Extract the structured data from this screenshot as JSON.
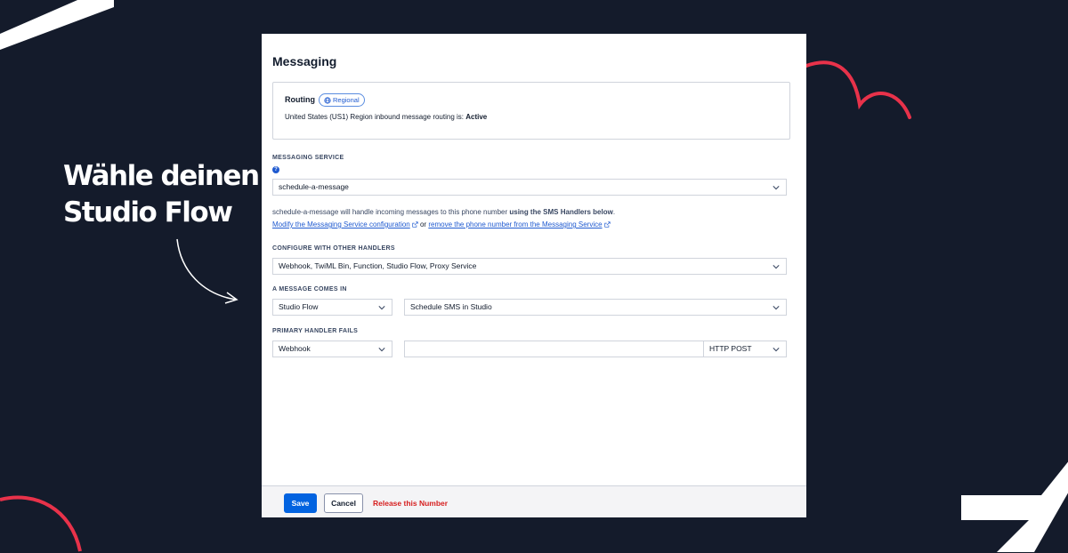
{
  "headline": {
    "line1": "Wähle deinen",
    "line2": "Studio Flow"
  },
  "panel": {
    "title": "Messaging",
    "routing": {
      "label": "Routing",
      "badge": "Regional",
      "text_prefix": "United States (US1) Region inbound message routing is: ",
      "status": "Active"
    },
    "messaging_service": {
      "label": "MESSAGING SERVICE",
      "value": "schedule-a-message",
      "note_prefix": "schedule-a-message will handle incoming messages to this phone number ",
      "note_bold": "using the SMS Handlers below",
      "note_suffix": ".",
      "modify_link": "Modify the Messaging Service configuration",
      "or_text": "or",
      "remove_link": "remove the phone number from the Messaging Service"
    },
    "configure": {
      "label": "CONFIGURE WITH OTHER HANDLERS",
      "value": "Webhook, TwiML Bin, Function, Studio Flow, Proxy Service"
    },
    "message_comes_in": {
      "label": "A MESSAGE COMES IN",
      "type_value": "Studio Flow",
      "flow_value": "Schedule SMS in Studio"
    },
    "primary_handler_fails": {
      "label": "PRIMARY HANDLER FAILS",
      "type_value": "Webhook",
      "url_value": "",
      "method_value": "HTTP POST"
    },
    "footer": {
      "save": "Save",
      "cancel": "Cancel",
      "release": "Release this Number"
    }
  },
  "colors": {
    "background": "#141b2b",
    "accent_red": "#e8324a",
    "primary_blue": "#0263e0",
    "danger_red": "#d61f1f"
  }
}
